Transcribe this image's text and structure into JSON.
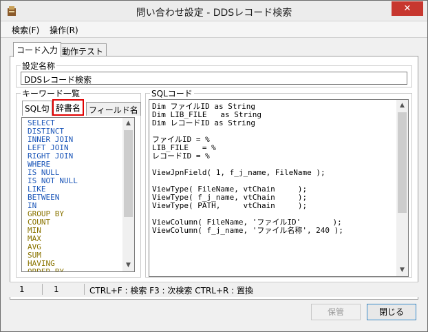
{
  "window": {
    "title": "問い合わせ設定 - DDSレコード検索",
    "close_glyph": "✕"
  },
  "menu": [
    {
      "label": "検索(F)"
    },
    {
      "label": "操作(R)"
    }
  ],
  "tabs": [
    {
      "label": "コード入力",
      "active": true
    },
    {
      "label": "動作テスト",
      "active": false
    }
  ],
  "setting_name": {
    "legend": "設定名称",
    "value": "DDSレコード検索"
  },
  "keywords": {
    "legend": "キーワード一覧",
    "tabs": [
      {
        "label": "SQL句",
        "active": true
      },
      {
        "label": "辞書名",
        "highlighted": true
      },
      {
        "label": "フィールド名"
      }
    ],
    "items": [
      {
        "text": "SELECT",
        "color": "#1a55b8"
      },
      {
        "text": "DISTINCT",
        "color": "#1a55b8"
      },
      {
        "text": "INNER JOIN",
        "color": "#1a55b8"
      },
      {
        "text": "LEFT JOIN",
        "color": "#1a55b8"
      },
      {
        "text": "RIGHT JOIN",
        "color": "#1a55b8"
      },
      {
        "text": "WHERE",
        "color": "#1a55b8"
      },
      {
        "text": "IS NULL",
        "color": "#1a55b8"
      },
      {
        "text": "IS NOT NULL",
        "color": "#1a55b8"
      },
      {
        "text": "LIKE",
        "color": "#1a55b8"
      },
      {
        "text": "BETWEEN",
        "color": "#1a55b8"
      },
      {
        "text": "IN",
        "color": "#1a55b8"
      },
      {
        "text": "GROUP BY",
        "color": "#8a7400"
      },
      {
        "text": "COUNT",
        "color": "#8a7400"
      },
      {
        "text": "MIN",
        "color": "#8a7400"
      },
      {
        "text": "MAX",
        "color": "#8a7400"
      },
      {
        "text": "AVG",
        "color": "#8a7400"
      },
      {
        "text": "SUM",
        "color": "#8a7400"
      },
      {
        "text": "HAVING",
        "color": "#8a7400"
      },
      {
        "text": "ORDER BY",
        "color": "#8a7400"
      }
    ]
  },
  "sql": {
    "legend": "SQLコード",
    "lines": [
      "Dim ファイルID as String",
      "Dim LIB_FILE   as String",
      "Dim レコードID as String",
      "",
      "ファイルID = %",
      "LIB_FILE   = %",
      "レコードID = %",
      "",
      "ViewJpnField( 1, f_j_name, FileName );",
      "",
      "ViewType( FileName, vtChain     );",
      "ViewType( f_j_name, vtChain     );",
      "ViewType( PATH,     vtChain     );",
      "",
      "ViewColumn( FileName, 'ファイルID'       );",
      "ViewColumn( f_j_name, 'ファイル名称', 240 );"
    ]
  },
  "status": {
    "line": "1",
    "col": "1",
    "hints": "CTRL+F : 検索  F3 : 次検索  CTRL+R : 置換"
  },
  "buttons": {
    "save": "保管",
    "close": "閉じる"
  }
}
